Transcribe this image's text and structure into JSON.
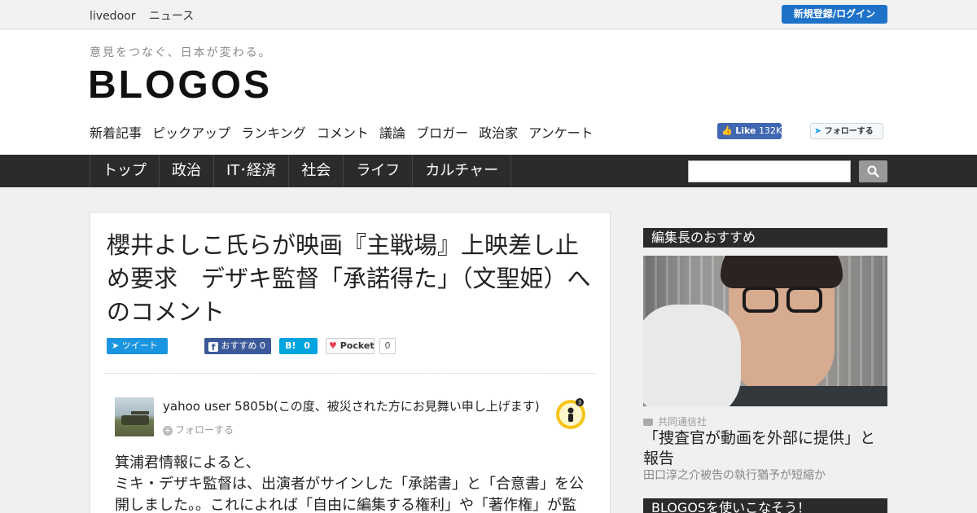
{
  "topbar": {
    "links": [
      "livedoor",
      "ニュース"
    ],
    "login_label": "新規登録/ログイン"
  },
  "header": {
    "tagline": "意見をつなぐ、日本が変わる。",
    "logo": "BLOGOS",
    "subnav": [
      "新着記事",
      "ピックアップ",
      "ランキング",
      "コメント",
      "議論",
      "ブロガー",
      "政治家",
      "アンケート"
    ],
    "fb_like_label": "Like",
    "fb_like_count": "132K",
    "tw_follow_label": "フォローする"
  },
  "mainnav": {
    "items": [
      "トップ",
      "政治",
      "IT･経済",
      "社会",
      "ライフ",
      "カルチャー"
    ],
    "search_placeholder": ""
  },
  "article": {
    "title": "櫻井よしこ氏らが映画『主戦場』上映差し止め要求　デザキ監督「承諾得た」（文聖姫）へのコメント",
    "share": {
      "tweet_label": "ツイート",
      "fb_label": "おすすめ",
      "fb_count": "0",
      "hatena_label": "B!",
      "hatena_count": "0",
      "pocket_label": "Pocket",
      "pocket_count": "0"
    },
    "comment": {
      "username": "yahoo user 5805b(この度、被災された方にお見舞い申し上げます)",
      "follow_label": "フォローする",
      "badge_count": "3",
      "lines": [
        "箕浦君情報によると、",
        "ミキ・デザキ監督は、出演者がサインした「承諾書」と「合意書」を公",
        "開しました。。これによれば「自由に編集する権利」や「著作権」が監"
      ]
    }
  },
  "sidebar": {
    "recommend_title": "編集長のおすすめ",
    "credit": "共同通信社",
    "headline": "「捜査官が動画を外部に提供」と報告",
    "subhead": "田口淳之介被告の執行猶予が短縮か",
    "guide_title": "BLOGOSを使いこなそう！"
  },
  "colors": {
    "nav_bg": "#2b2b2b",
    "login_blue": "#1e73c8",
    "twitter_blue": "#1b95e0",
    "facebook_blue": "#3b5998",
    "hatena_blue": "#00a4de",
    "pocket_red": "#ef4056"
  }
}
